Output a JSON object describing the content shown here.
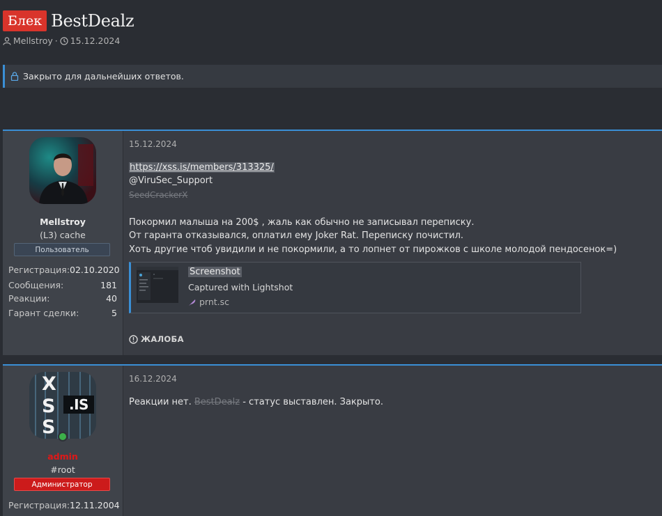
{
  "thread": {
    "prefix": "Блек",
    "title": "BestDealz",
    "author": "Mellstroy",
    "separator": "·",
    "date": "15.12.2024"
  },
  "notice": {
    "text": "Закрыто для дальнейших ответов."
  },
  "posts": [
    {
      "user": {
        "name": "Mellstroy",
        "title": "(L3) cache",
        "banner": "Пользователь",
        "stats": [
          {
            "label": "Регистрация:",
            "value": "02.10.2020"
          },
          {
            "label": "Сообщения:",
            "value": "181"
          },
          {
            "label": "Реакции:",
            "value": "40"
          },
          {
            "label": "Гарант сделки:",
            "value": "5"
          }
        ]
      },
      "date": "15.12.2024",
      "link": "https://xss.is/members/313325/",
      "handle": "@ViruSec_Support",
      "struck": "SeedCrackerX",
      "lines": [
        "Покормил малыша на 200$ , жаль как обычно не записывал переписку.",
        "От гаранта отказывался, оплатил ему Joker Rat. Переписку почистил.",
        "Хоть другие чтоб увидили и не покормили, а то лопнет от пирожков с школе молодой пендосенок=)"
      ],
      "embed": {
        "title": "Screenshot",
        "description": "Captured with Lightshot",
        "site": "prnt.sc"
      },
      "report_label": "ЖАЛОБА"
    },
    {
      "user": {
        "name": "admin",
        "title": "#root",
        "banner": "Администратор",
        "avatar_text": ".IS",
        "stats": [
          {
            "label": "Регистрация:",
            "value": "12.11.2004"
          }
        ]
      },
      "date": "16.12.2024",
      "text_before": "Реакции нет.",
      "struck": "BestDealz",
      "text_after": "- статус выставлен. Закрыто."
    }
  ],
  "colors": {
    "accent": "#3a8fd6",
    "prefix_bg": "#d9342b",
    "admin_name": "#e01818",
    "online": "#3cb04a"
  }
}
